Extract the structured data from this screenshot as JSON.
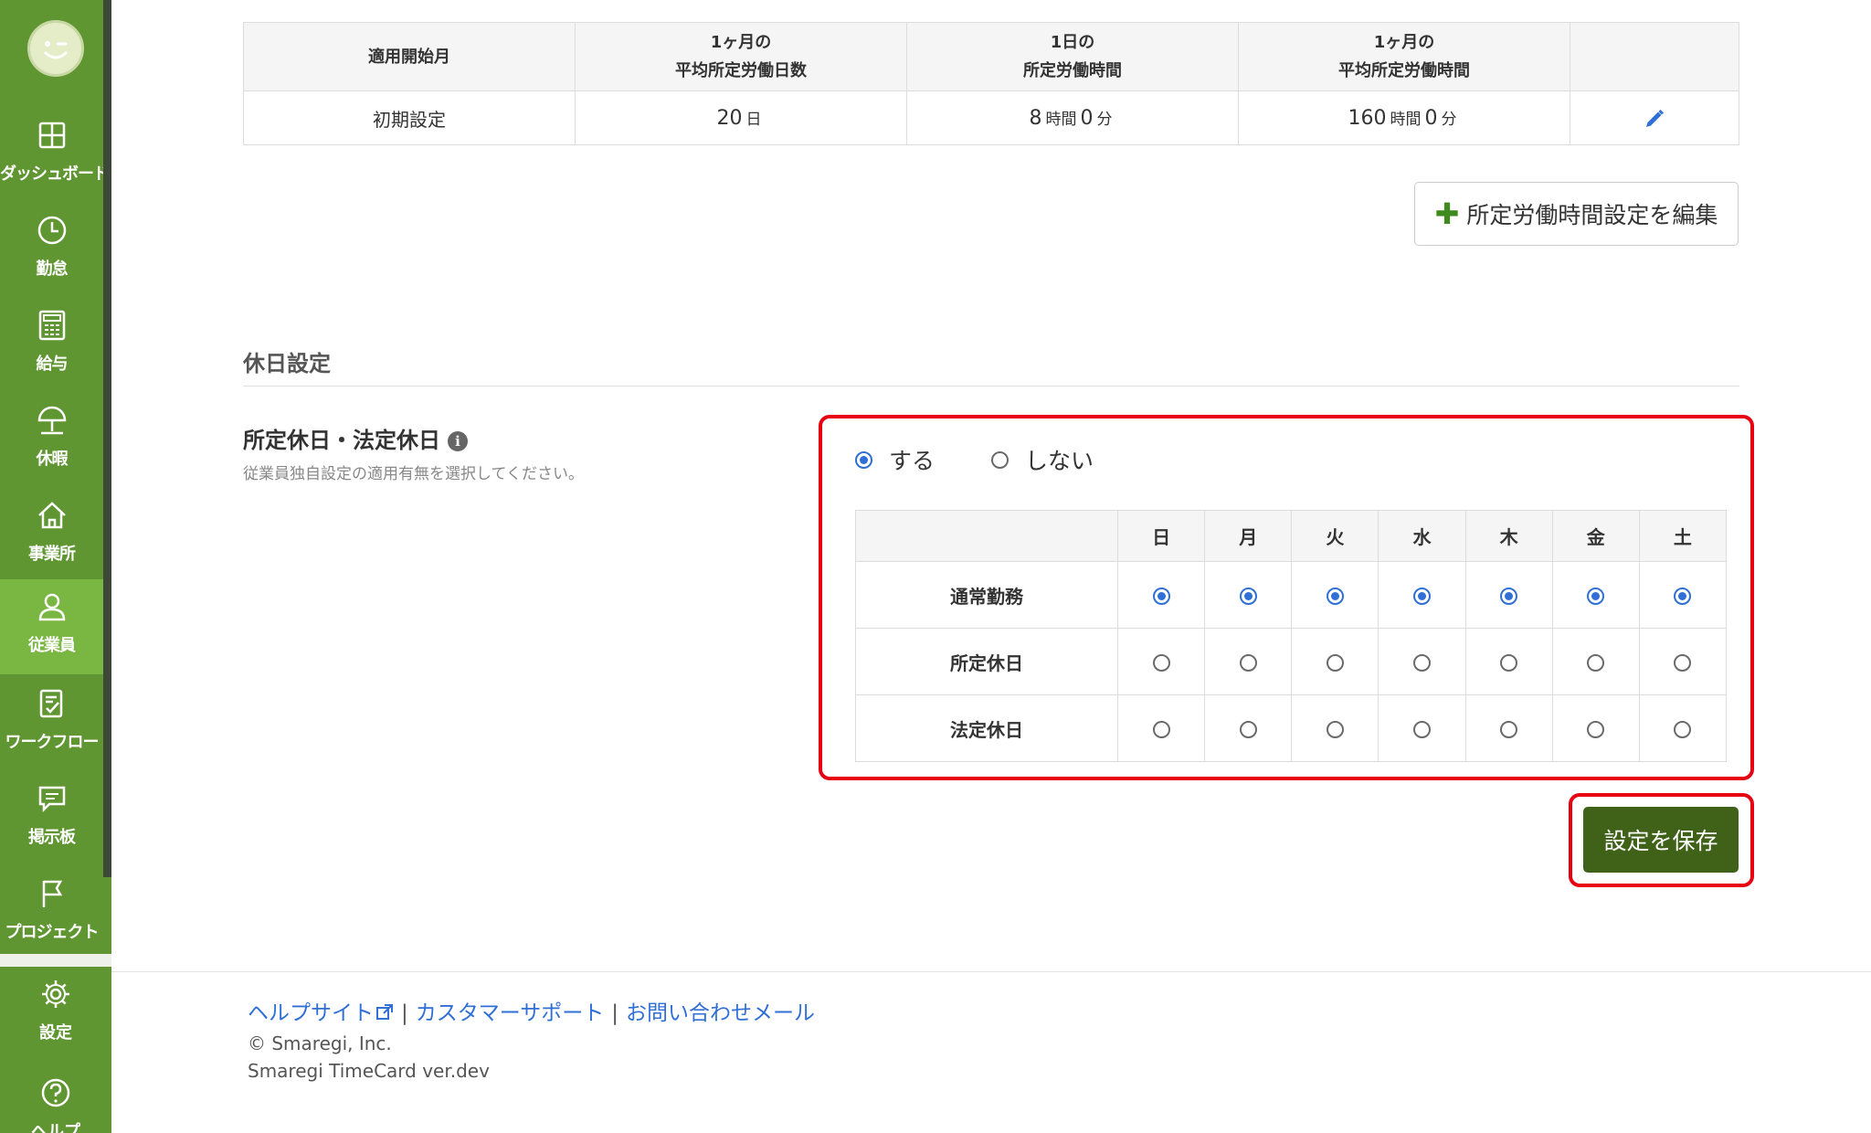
{
  "sidebar": {
    "items": [
      {
        "label": "ダッシュボード",
        "icon": "dashboard-icon"
      },
      {
        "label": "勤怠",
        "icon": "clock-icon"
      },
      {
        "label": "給与",
        "icon": "calculator-icon"
      },
      {
        "label": "休暇",
        "icon": "umbrella-icon"
      },
      {
        "label": "事業所",
        "icon": "home-icon"
      },
      {
        "label": "従業員",
        "icon": "user-icon",
        "active": true
      },
      {
        "label": "ワークフロー",
        "icon": "checklist-icon"
      },
      {
        "label": "掲示板",
        "icon": "chat-icon"
      },
      {
        "label": "プロジェクト",
        "icon": "flag-icon"
      }
    ],
    "settings_label": "設定",
    "help_label": "ヘルプ"
  },
  "work_table": {
    "headers": [
      "適用開始月",
      "1ヶ月の\n平均所定労働日数",
      "1日の\n所定労働時間",
      "1ヶ月の\n平均所定労働時間",
      ""
    ],
    "row": {
      "start": "初期設定",
      "days": "20",
      "days_unit": "日",
      "daily_hours": "8",
      "daily_minutes": "0",
      "monthly_hours": "160",
      "monthly_minutes": "0",
      "hours_unit": "時間",
      "minutes_unit": "分"
    }
  },
  "edit_button_label": "所定労働時間設定を編集",
  "holiday_section": {
    "title": "休日設定",
    "field_label": "所定休日・法定休日",
    "help_text": "従業員独自設定の適用有無を選択してください。",
    "options": [
      {
        "label": "する",
        "selected": true
      },
      {
        "label": "しない",
        "selected": false
      }
    ],
    "days": [
      "日",
      "月",
      "火",
      "水",
      "木",
      "金",
      "土"
    ],
    "rows": [
      {
        "label": "通常勤務",
        "selected": [
          true,
          true,
          true,
          true,
          true,
          true,
          true
        ]
      },
      {
        "label": "所定休日",
        "selected": [
          false,
          false,
          false,
          false,
          false,
          false,
          false
        ]
      },
      {
        "label": "法定休日",
        "selected": [
          false,
          false,
          false,
          false,
          false,
          false,
          false
        ]
      }
    ]
  },
  "save_button_label": "設定を保存",
  "footer": {
    "links": [
      "ヘルプサイト",
      "カスタマーサポート",
      "お問い合わせメール"
    ],
    "copyright": "© Smaregi, Inc.",
    "version": "Smaregi TimeCard ver.dev"
  },
  "colors": {
    "sidebar": "#5f9631",
    "sidebar_active": "#7ab642",
    "save_button": "#3f6118",
    "highlight": "#e60012",
    "link": "#2f6fd6",
    "radio": "#2f6fd6"
  }
}
